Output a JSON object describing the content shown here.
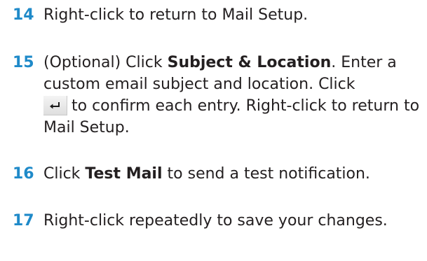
{
  "accent_color": "#1f8ac9",
  "steps": [
    {
      "number": "14",
      "text": "Right-click to return to Mail Setup."
    },
    {
      "number": "15",
      "prefix": "(Optional) Click ",
      "bold": "Subject & Location",
      "middle": ". Enter a custom email subject and location. Click",
      "icon": "enter-return-icon",
      "suffix": "to confirm each entry. Right-click to return to Mail Setup."
    },
    {
      "number": "16",
      "prefix": "Click ",
      "bold": "Test Mail",
      "suffix": " to send a test notification."
    },
    {
      "number": "17",
      "text": "Right-click repeatedly to save your changes."
    }
  ]
}
